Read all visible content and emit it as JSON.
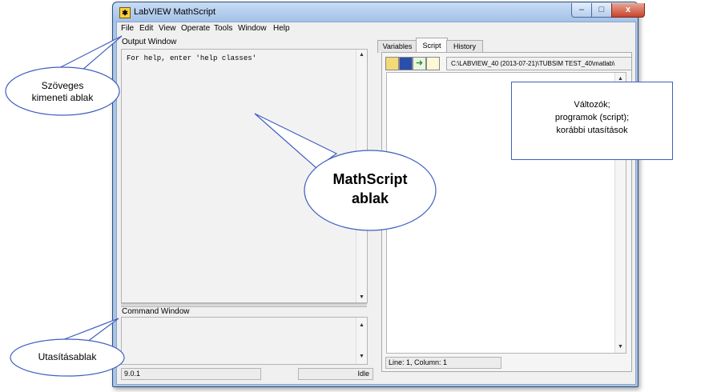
{
  "window": {
    "title": "LabVIEW MathScript",
    "app_icon": "labview-icon",
    "controls": {
      "minimize": "–",
      "maximize": "□",
      "close": "x"
    }
  },
  "menu": [
    "File",
    "Edit",
    "View",
    "Operate",
    "Tools",
    "Window",
    "Help"
  ],
  "output_window": {
    "label": "Output Window",
    "text": "For help, enter 'help classes'"
  },
  "command_window": {
    "label": "Command Window",
    "text": ""
  },
  "tabs": [
    {
      "label": "Variables",
      "active": false
    },
    {
      "label": "Script",
      "active": true
    },
    {
      "label": "History",
      "active": false
    }
  ],
  "script_toolbar": {
    "icons": [
      "open-folder-icon",
      "save-icon",
      "run-icon",
      "new-script-icon"
    ],
    "path": "C:\\LABVIEW_40 (2013-07-21)\\TUBSIM TEST_40\\matlab\\"
  },
  "status_bar": {
    "version": "9.0.1",
    "state": "Idle",
    "position": "Line: 1, Column: 1"
  },
  "annotations": {
    "output_callout": [
      "Szöveges",
      "kimeneti ablak"
    ],
    "mathscript_callout": [
      "MathScript",
      "ablak"
    ],
    "command_callout": "Utasításablak",
    "right_note": [
      "Változók;",
      "programok (script);",
      "korábbi utasítások"
    ]
  },
  "colors": {
    "title_bar": "#a3c1e8",
    "close_button": "#c8442b",
    "callout_border": "#3f5fbf"
  }
}
